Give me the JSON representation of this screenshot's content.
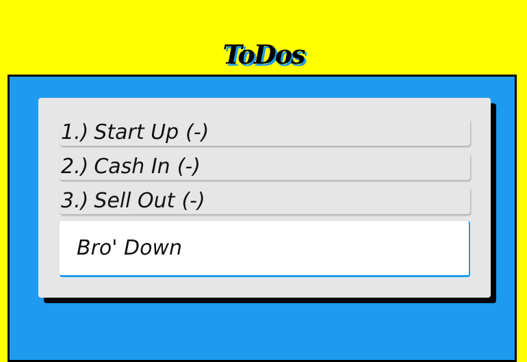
{
  "app": {
    "title": "ToDos"
  },
  "todos": [
    {
      "number": "1.)",
      "text": "Start Up",
      "remove_label": "(-)"
    },
    {
      "number": "2.)",
      "text": "Cash In",
      "remove_label": "(-)"
    },
    {
      "number": "3.)",
      "text": "Sell Out",
      "remove_label": "(-)"
    }
  ],
  "new_todo": {
    "value": "Bro' Down"
  },
  "colors": {
    "page_background": "#ffff00",
    "board_background": "#1e9bef",
    "panel_background": "#e6e6e6",
    "accent": "#1e9bef"
  }
}
